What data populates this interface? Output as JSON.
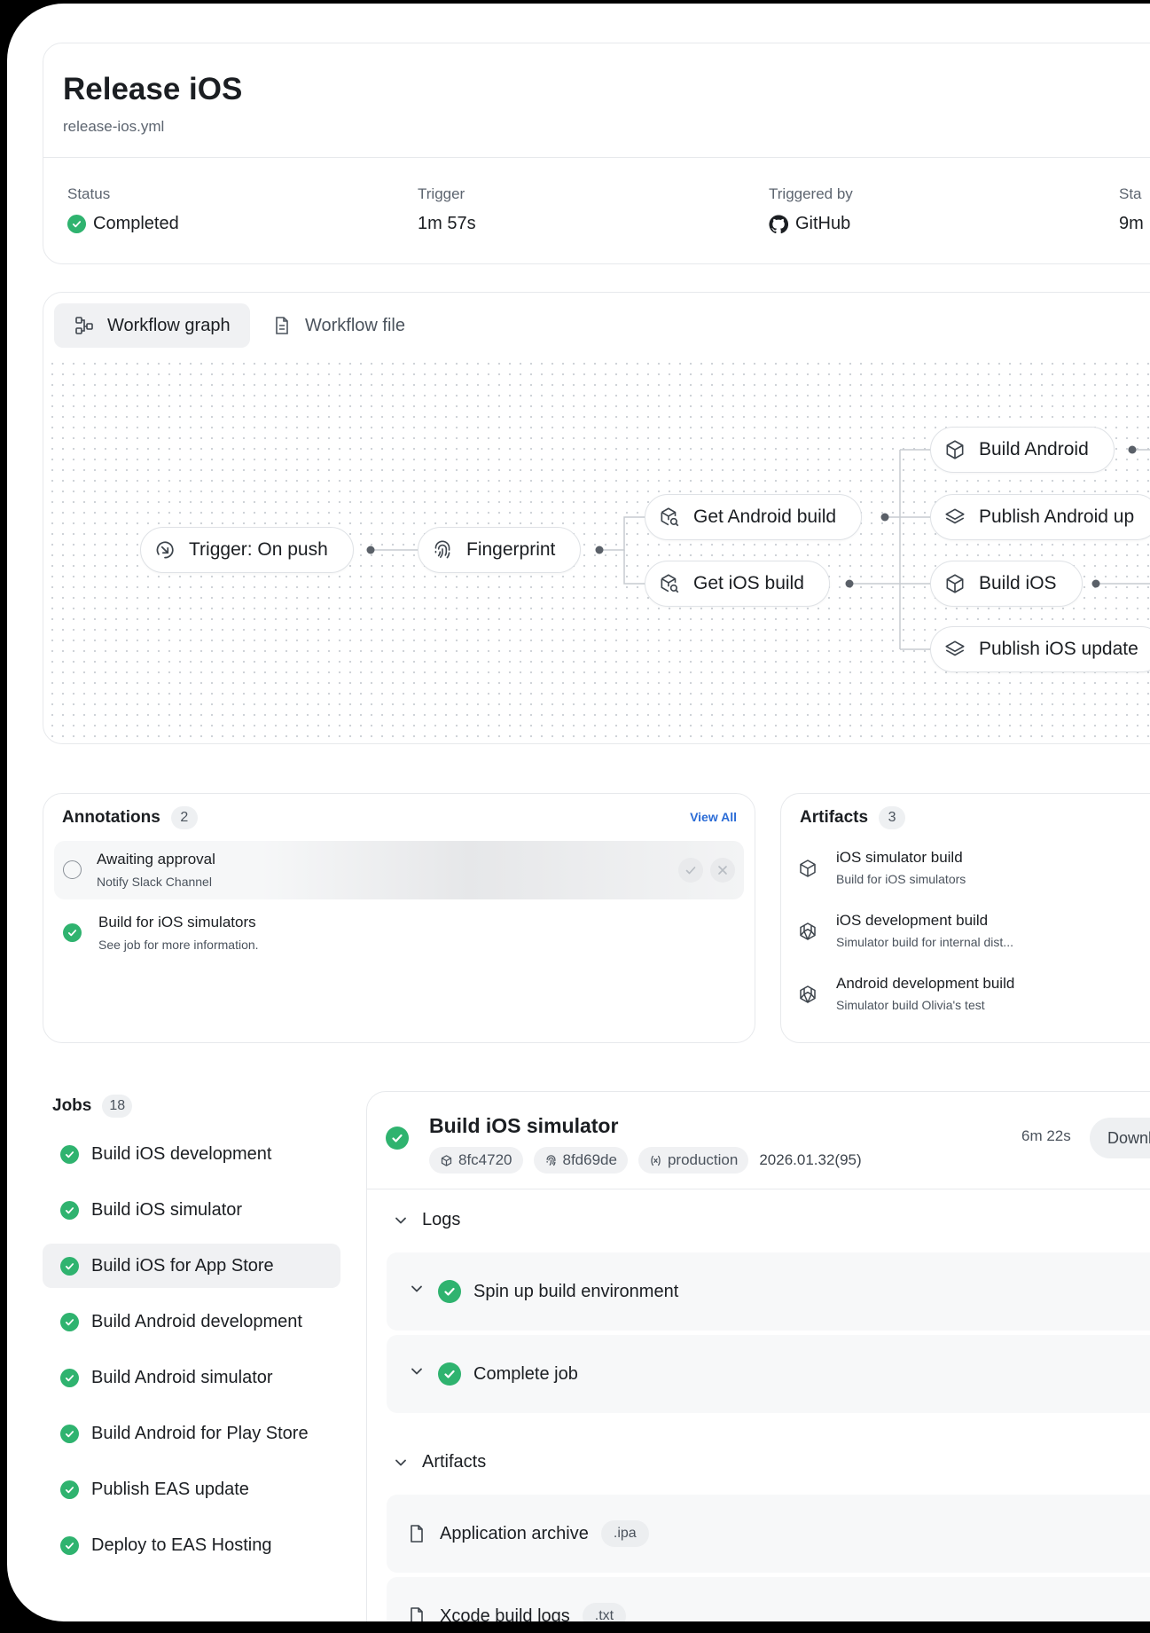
{
  "header": {
    "title": "Release iOS",
    "file": "release-ios.yml",
    "stats": [
      {
        "label": "Status",
        "value": "Completed",
        "icon": "check-circle-icon"
      },
      {
        "label": "Trigger",
        "value": "1m 57s"
      },
      {
        "label": "Triggered by",
        "value": "GitHub",
        "icon": "github-icon"
      },
      {
        "label": "Sta",
        "value": "9m"
      }
    ]
  },
  "graph": {
    "tabs": [
      {
        "label": "Workflow graph",
        "icon": "graph-icon",
        "active": true
      },
      {
        "label": "Workflow file",
        "icon": "file-icon",
        "active": false
      }
    ],
    "nodes": [
      {
        "id": "trigger",
        "label": "Trigger: On push",
        "icon": "trigger-icon"
      },
      {
        "id": "fingerprint",
        "label": "Fingerprint",
        "icon": "fingerprint-icon"
      },
      {
        "id": "get-android",
        "label": "Get Android build",
        "icon": "build-search-icon"
      },
      {
        "id": "get-ios",
        "label": "Get iOS build",
        "icon": "build-search-icon"
      },
      {
        "id": "build-android",
        "label": "Build Android",
        "icon": "cube-icon"
      },
      {
        "id": "publish-android",
        "label": "Publish Android up",
        "icon": "layers-icon"
      },
      {
        "id": "build-ios",
        "label": "Build iOS",
        "icon": "cube-icon"
      },
      {
        "id": "publish-ios",
        "label": "Publish iOS update",
        "icon": "layers-icon"
      }
    ]
  },
  "annotations": {
    "title": "Annotations",
    "count": "2",
    "view_all": "View All",
    "items": [
      {
        "title": "Awaiting approval",
        "subtitle": "Notify Slack Channel",
        "state": "pending"
      },
      {
        "title": "Build for iOS simulators",
        "subtitle": "See job for more information.",
        "state": "done"
      }
    ]
  },
  "artifacts_card": {
    "title": "Artifacts",
    "count": "3",
    "items": [
      {
        "title": "iOS simulator build",
        "subtitle": "Build for iOS simulators",
        "icon": "cube-icon"
      },
      {
        "title": "iOS development build",
        "subtitle": "Simulator build for internal dist...",
        "icon": "aperture-icon"
      },
      {
        "title": "Android development build",
        "subtitle": "Simulator build Olivia's test",
        "icon": "aperture-icon"
      }
    ]
  },
  "jobs": {
    "title": "Jobs",
    "count": "18",
    "items": [
      {
        "label": "Build iOS development"
      },
      {
        "label": "Build iOS simulator"
      },
      {
        "label": "Build iOS for App Store",
        "active": true
      },
      {
        "label": "Build Android development"
      },
      {
        "label": "Build Android simulator"
      },
      {
        "label": "Build Android for Play Store"
      },
      {
        "label": "Publish EAS update"
      },
      {
        "label": "Deploy to EAS Hosting"
      }
    ]
  },
  "detail": {
    "title": "Build iOS simulator",
    "chips": [
      "8fc4720",
      "8fd69de",
      "production"
    ],
    "version": "2026.01.32(95)",
    "duration": "6m 22s",
    "download_label": "Downlo",
    "logs_label": "Logs",
    "logs": [
      "Spin up build environment",
      "Complete job"
    ],
    "artifacts_label": "Artifacts",
    "artifacts": [
      {
        "name": "Application archive",
        "ext": ".ipa"
      },
      {
        "name": "Xcode build logs",
        "ext": ".txt"
      }
    ]
  },
  "colors": {
    "success": "#2fb36f",
    "link": "#2b6cd6",
    "border": "#e7e9ec"
  }
}
